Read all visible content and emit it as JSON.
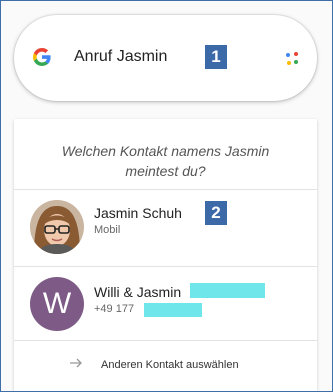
{
  "search": {
    "logo_letter": "G",
    "query": "Anruf Jasmin",
    "badge": "1"
  },
  "card": {
    "question_line1": "Welchen Kontakt namens Jasmin",
    "question_line2": "meintest du?",
    "contacts": [
      {
        "name": "Jasmin Schuh",
        "subtitle": "Mobil",
        "badge": "2"
      },
      {
        "name": "Willi & Jasmin",
        "subtitle": "+49 177",
        "avatar_initial": "W"
      }
    ],
    "other_contact_label": "Anderen Kontakt auswählen"
  },
  "colors": {
    "badge_bg": "#3c6aa8",
    "redaction": "#6fe7ea",
    "avatar_w": "#7e5b86"
  },
  "icons": {
    "google_logo": "google-g-icon",
    "assistant": "assistant-dots-icon",
    "arrow": "arrow-right-icon"
  }
}
